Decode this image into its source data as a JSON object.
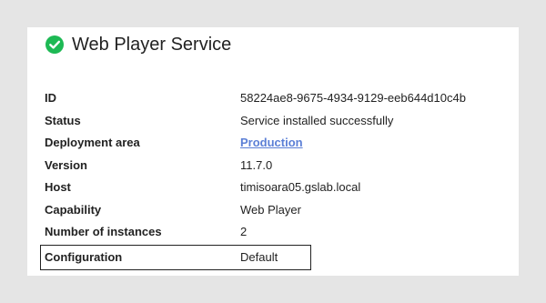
{
  "service": {
    "title": "Web Player Service",
    "status_icon": "check-circle-icon",
    "status_color": "#1db954"
  },
  "details": [
    {
      "label": "ID",
      "value": "58224ae8-9675-4934-9129-eeb644d10c4b"
    },
    {
      "label": "Status",
      "value": "Service installed successfully"
    },
    {
      "label": "Deployment area",
      "value": "Production"
    },
    {
      "label": "Version",
      "value": "11.7.0"
    },
    {
      "label": "Host",
      "value": "timisoara05.gslab.local"
    },
    {
      "label": "Capability",
      "value": "Web Player"
    },
    {
      "label": "Number of instances",
      "value": "2"
    },
    {
      "label": "Configuration",
      "value": "Default"
    }
  ]
}
